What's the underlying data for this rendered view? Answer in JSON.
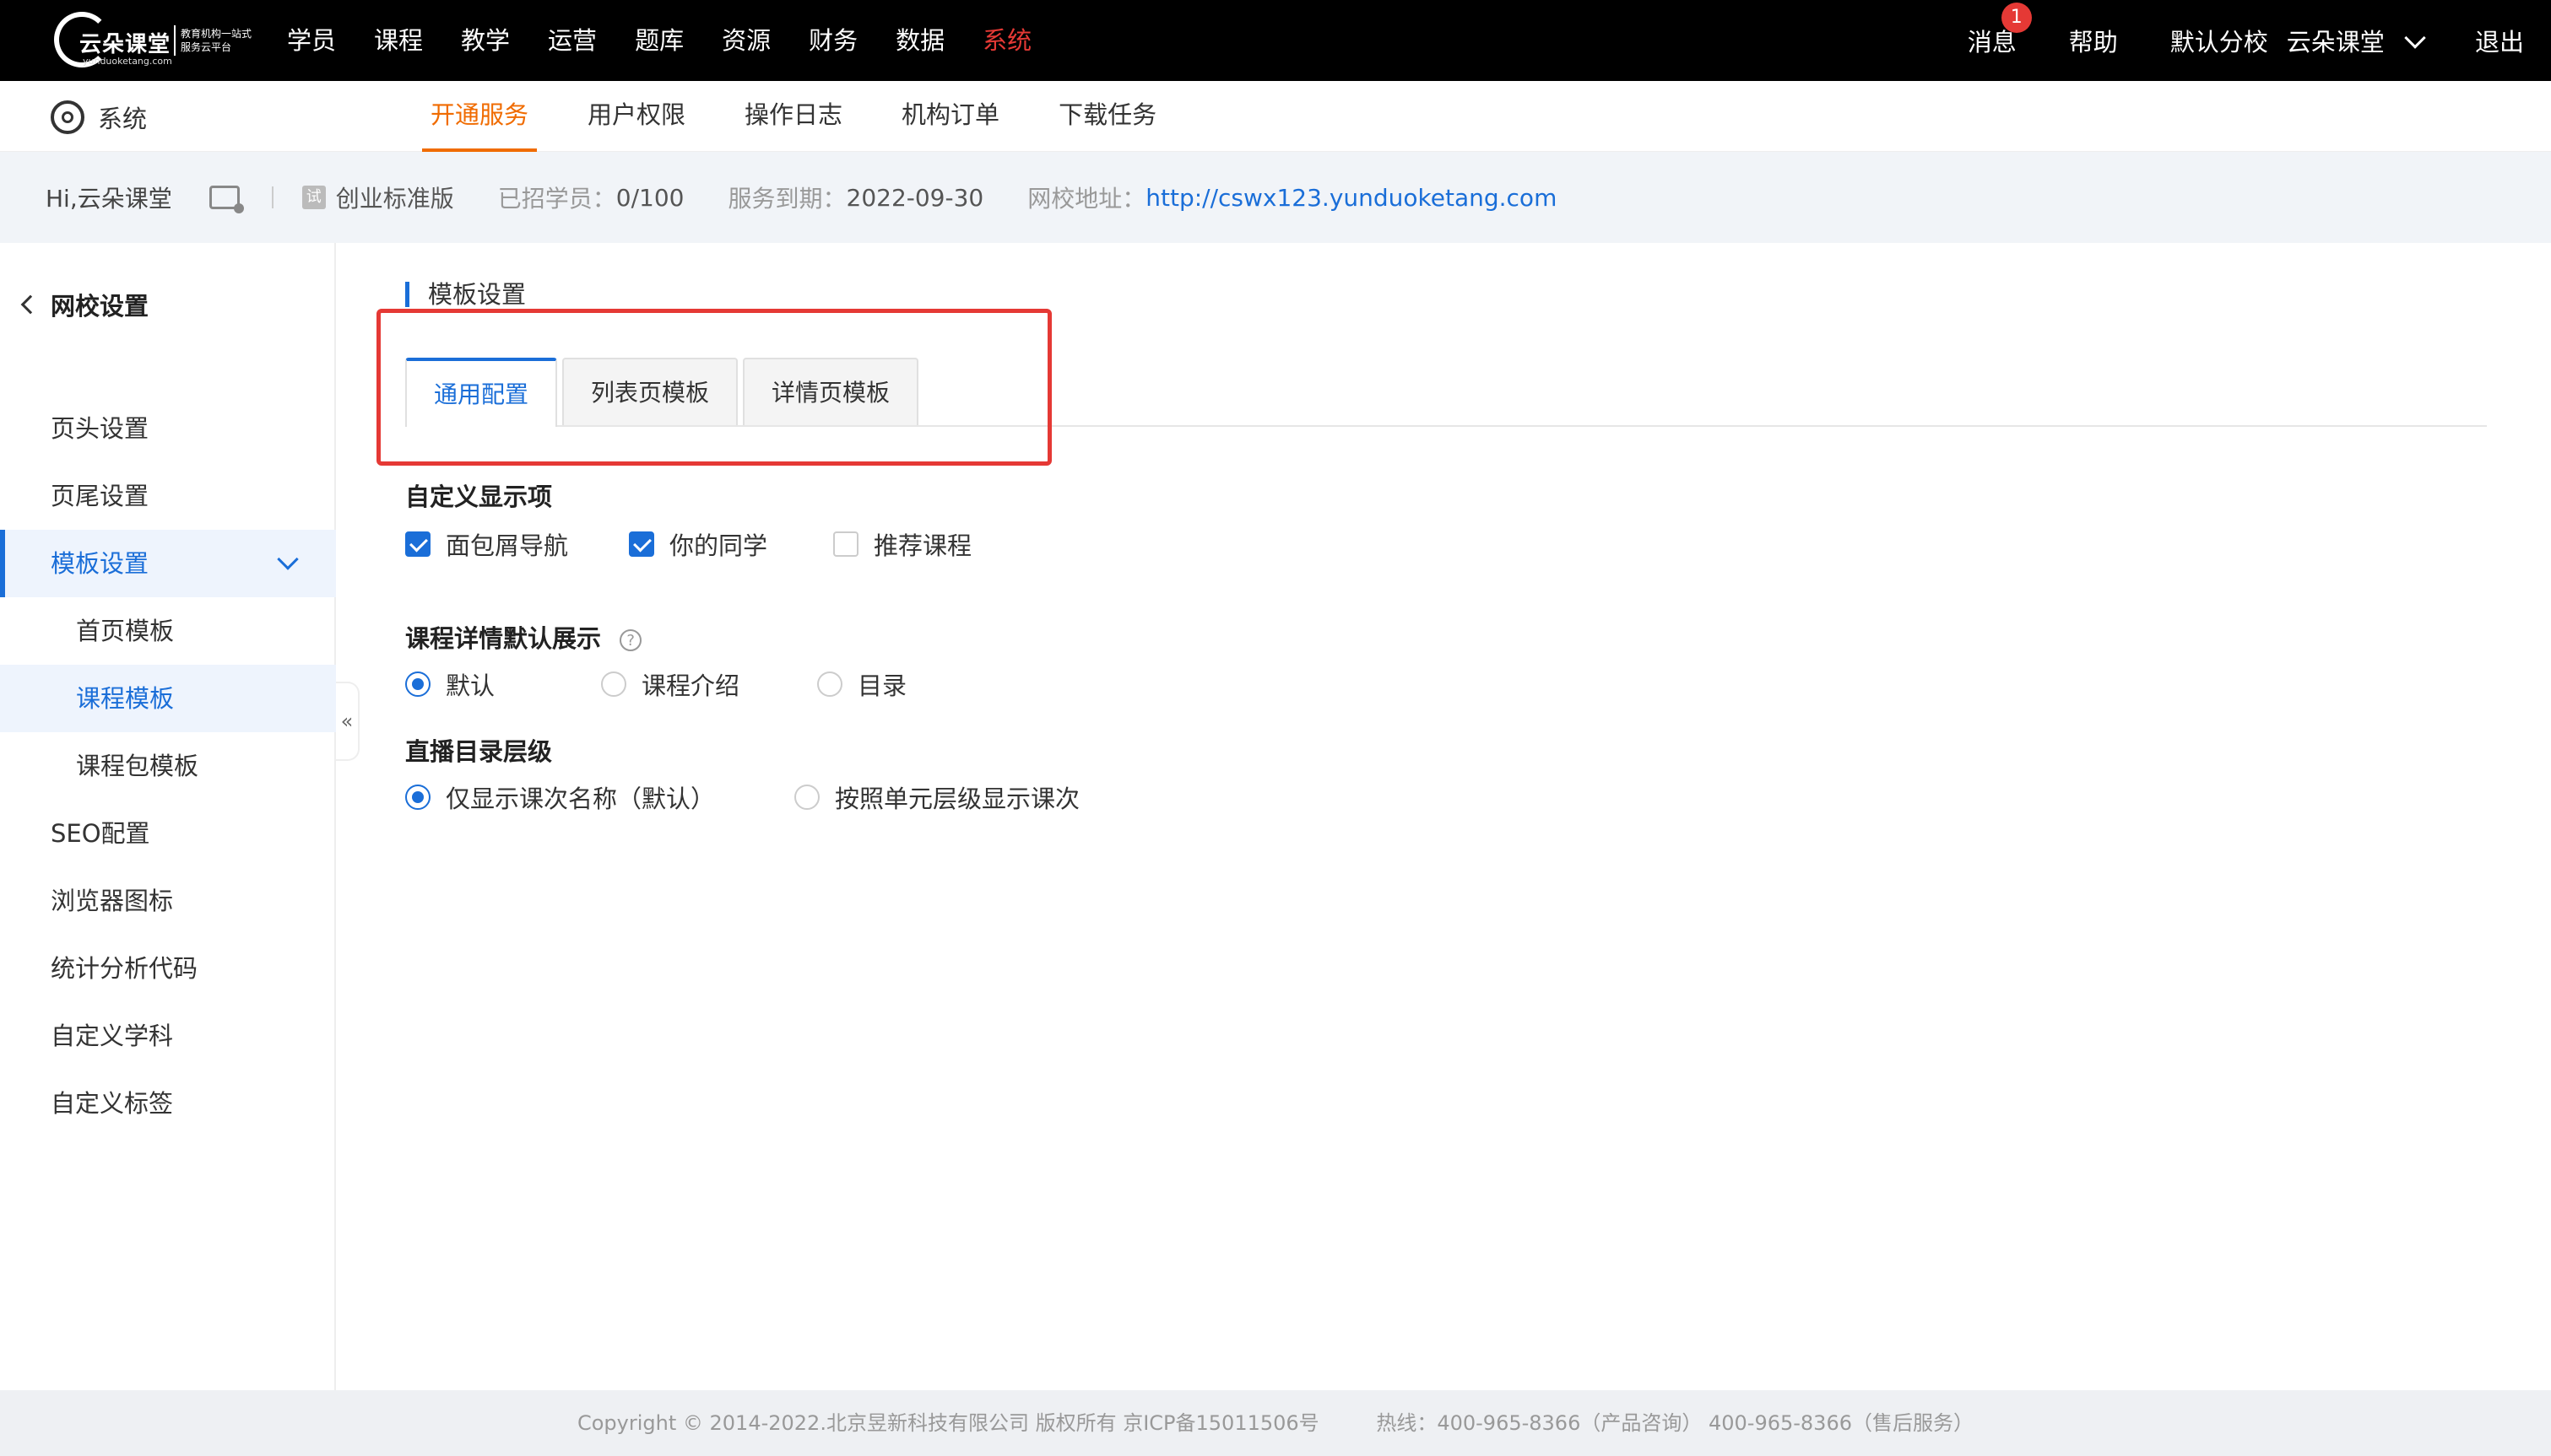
{
  "topbar": {
    "logo": {
      "brand": "云朵课堂",
      "url": "yunduoketang.com",
      "slogan": "教育机构一站式服务云平台"
    },
    "nav": [
      "学员",
      "课程",
      "教学",
      "运营",
      "题库",
      "资源",
      "财务",
      "数据",
      "系统"
    ],
    "active_nav": "系统",
    "right": {
      "messages": "消息",
      "badge": "1",
      "help": "帮助",
      "branch": "默认分校",
      "school": "云朵课堂",
      "logout": "退出"
    }
  },
  "subbar": {
    "section": "系统",
    "tabs": [
      "开通服务",
      "用户权限",
      "操作日志",
      "机构订单",
      "下载任务"
    ],
    "active_tab": "开通服务"
  },
  "info": {
    "greeting": "Hi,云朵课堂",
    "trial_mark": "试",
    "edition": "创业标准版",
    "students_label": "已招学员：",
    "students_value": "0/100",
    "expire_label": "服务到期：",
    "expire_value": "2022-09-30",
    "site_label": "网校地址：",
    "site_url": "http://cswx123.yunduoketang.com"
  },
  "sidebar": {
    "back": "网校设置",
    "items": [
      {
        "label": "页头设置"
      },
      {
        "label": "页尾设置"
      },
      {
        "label": "模板设置"
      },
      {
        "label": "首页模板"
      },
      {
        "label": "课程模板"
      },
      {
        "label": "课程包模板"
      },
      {
        "label": "SEO配置"
      },
      {
        "label": "浏览器图标"
      },
      {
        "label": "统计分析代码"
      },
      {
        "label": "自定义学科"
      },
      {
        "label": "自定义标签"
      }
    ],
    "collapse": "«"
  },
  "main": {
    "title": "模板设置",
    "tabs": [
      "通用配置",
      "列表页模板",
      "详情页模板"
    ],
    "active_tab": "通用配置",
    "display_group": {
      "title": "自定义显示项",
      "options": [
        {
          "label": "面包屑导航",
          "checked": true
        },
        {
          "label": "你的同学",
          "checked": true
        },
        {
          "label": "推荐课程",
          "checked": false
        }
      ]
    },
    "detail_group": {
      "title": "课程详情默认展示",
      "help": "?",
      "options": [
        {
          "label": "默认",
          "selected": true
        },
        {
          "label": "课程介绍",
          "selected": false
        },
        {
          "label": "目录",
          "selected": false
        }
      ]
    },
    "live_group": {
      "title": "直播目录层级",
      "options": [
        {
          "label": "仅显示课次名称（默认）",
          "selected": true
        },
        {
          "label": "按照单元层级显示课次",
          "selected": false
        }
      ]
    }
  },
  "footer": {
    "copyright": "Copyright © 2014-2022.北京昱新科技有限公司 版权所有 京ICP备15011506号",
    "hotline": "热线：400-965-8366（产品咨询） 400-965-8366（售后服务）"
  },
  "colors": {
    "accent": "#1a6ed8",
    "active_top": "#e53935",
    "active_sub": "#f06b00",
    "highlight_box": "#e53935"
  }
}
